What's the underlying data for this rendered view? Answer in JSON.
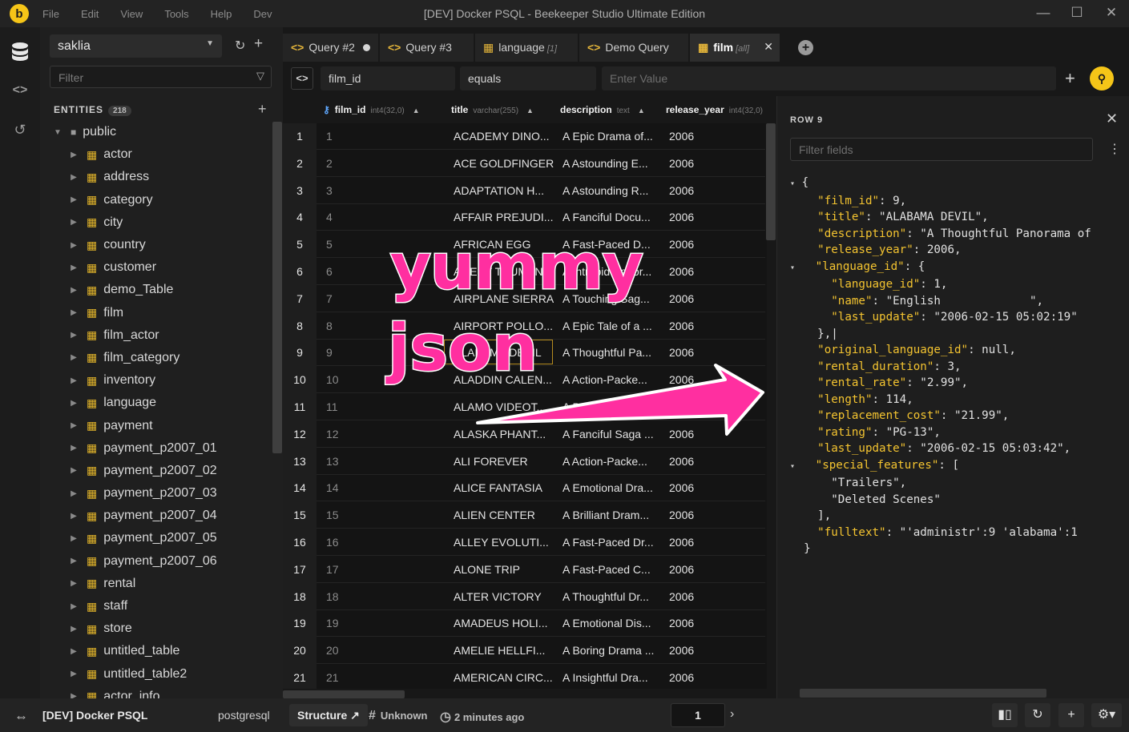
{
  "app": {
    "logo": "b",
    "title": "[DEV] Docker PSQL - Beekeeper Studio Ultimate Edition",
    "menu": [
      "File",
      "Edit",
      "View",
      "Tools",
      "Help",
      "Dev"
    ]
  },
  "sidebar": {
    "connection": "saklia",
    "filter_placeholder": "Filter",
    "entities_label": "ENTITIES",
    "entities_count": "218",
    "schema": "public",
    "tables": [
      "actor",
      "address",
      "category",
      "city",
      "country",
      "customer",
      "demo_Table",
      "film",
      "film_actor",
      "film_category",
      "inventory",
      "language",
      "payment",
      "payment_p2007_01",
      "payment_p2007_02",
      "payment_p2007_03",
      "payment_p2007_04",
      "payment_p2007_05",
      "payment_p2007_06",
      "rental",
      "staff",
      "store",
      "untitled_table",
      "untitled_table2",
      "actor_info"
    ]
  },
  "tabs": [
    {
      "label": "Query #2",
      "kind": "query",
      "sub": ""
    },
    {
      "label": "Query #3",
      "kind": "query",
      "sub": ""
    },
    {
      "label": "language",
      "kind": "table",
      "sub": "[1]"
    },
    {
      "label": "Demo Query",
      "kind": "query",
      "sub": ""
    },
    {
      "label": "film",
      "kind": "table",
      "sub": "[all]"
    }
  ],
  "filter": {
    "field": "film_id",
    "operator": "equals",
    "value_placeholder": "Enter Value"
  },
  "grid": {
    "columns": [
      {
        "name": "film_id",
        "type": "int4(32,0)"
      },
      {
        "name": "title",
        "type": "varchar(255)"
      },
      {
        "name": "description",
        "type": "text"
      },
      {
        "name": "release_year",
        "type": "int4(32,0)"
      }
    ],
    "rows": [
      [
        "1",
        "1",
        "ACADEMY DINO...",
        "A Epic Drama of...",
        "2006"
      ],
      [
        "2",
        "2",
        "ACE GOLDFINGER",
        "A Astounding E...",
        "2006"
      ],
      [
        "3",
        "3",
        "ADAPTATION H...",
        "A Astounding R...",
        "2006"
      ],
      [
        "4",
        "4",
        "AFFAIR PREJUDI...",
        "A Fanciful Docu...",
        "2006"
      ],
      [
        "5",
        "5",
        "AFRICAN EGG",
        "A Fast-Paced D...",
        "2006"
      ],
      [
        "6",
        "6",
        "AGENT TRUMAN",
        "A Intrepid Panor...",
        "2006"
      ],
      [
        "7",
        "7",
        "AIRPLANE SIERRA",
        "A Touching Sag...",
        "2006"
      ],
      [
        "8",
        "8",
        "AIRPORT POLLO...",
        "A Epic Tale of a ...",
        "2006"
      ],
      [
        "9",
        "9",
        "ALABAMA DEVIL",
        "A Thoughtful Pa...",
        "2006"
      ],
      [
        "10",
        "10",
        "ALADDIN CALEN...",
        "A Action-Packe...",
        "2006"
      ],
      [
        "11",
        "11",
        "ALAMO VIDEOT...",
        "A Boring Epistle...",
        "2006"
      ],
      [
        "12",
        "12",
        "ALASKA PHANT...",
        "A Fanciful Saga ...",
        "2006"
      ],
      [
        "13",
        "13",
        "ALI FOREVER",
        "A Action-Packe...",
        "2006"
      ],
      [
        "14",
        "14",
        "ALICE FANTASIA",
        "A Emotional Dra...",
        "2006"
      ],
      [
        "15",
        "15",
        "ALIEN CENTER",
        "A Brilliant Dram...",
        "2006"
      ],
      [
        "16",
        "16",
        "ALLEY EVOLUTI...",
        "A Fast-Paced Dr...",
        "2006"
      ],
      [
        "17",
        "17",
        "ALONE TRIP",
        "A Fast-Paced C...",
        "2006"
      ],
      [
        "18",
        "18",
        "ALTER VICTORY",
        "A Thoughtful Dr...",
        "2006"
      ],
      [
        "19",
        "19",
        "AMADEUS HOLI...",
        "A Emotional Dis...",
        "2006"
      ],
      [
        "20",
        "20",
        "AMELIE HELLFI...",
        "A Boring Drama ...",
        "2006"
      ],
      [
        "21",
        "21",
        "AMERICAN CIRC...",
        "A Insightful Dra...",
        "2006"
      ]
    ]
  },
  "panel": {
    "title": "ROW 9",
    "filter_placeholder": "Filter fields",
    "json_lines": [
      {
        "i": 0,
        "a": "▾",
        "t": "{"
      },
      {
        "i": 1,
        "k": "\"film_id\"",
        "t": ": 9,"
      },
      {
        "i": 1,
        "k": "\"title\"",
        "t": ": \"ALABAMA DEVIL\","
      },
      {
        "i": 1,
        "k": "\"description\"",
        "t": ": \"A Thoughtful Panorama of"
      },
      {
        "i": 1,
        "k": "\"release_year\"",
        "t": ": 2006,"
      },
      {
        "i": 1,
        "a": "▾",
        "k": "\"language_id\"",
        "t": ": {"
      },
      {
        "i": 2,
        "k": "\"language_id\"",
        "t": ": 1,"
      },
      {
        "i": 2,
        "k": "\"name\"",
        "t": ": \"English             \","
      },
      {
        "i": 2,
        "k": "\"last_update\"",
        "t": ": \"2006-02-15 05:02:19\""
      },
      {
        "i": 1,
        "t": "},|"
      },
      {
        "i": 1,
        "k": "\"original_language_id\"",
        "t": ": null,"
      },
      {
        "i": 1,
        "k": "\"rental_duration\"",
        "t": ": 3,"
      },
      {
        "i": 1,
        "k": "\"rental_rate\"",
        "t": ": \"2.99\","
      },
      {
        "i": 1,
        "k": "\"length\"",
        "t": ": 114,"
      },
      {
        "i": 1,
        "k": "\"replacement_cost\"",
        "t": ": \"21.99\","
      },
      {
        "i": 1,
        "k": "\"rating\"",
        "t": ": \"PG-13\","
      },
      {
        "i": 1,
        "k": "\"last_update\"",
        "t": ": \"2006-02-15 05:03:42\","
      },
      {
        "i": 1,
        "a": "▾",
        "k": "\"special_features\"",
        "t": ": ["
      },
      {
        "i": 2,
        "t": "\"Trailers\","
      },
      {
        "i": 2,
        "t": "\"Deleted Scenes\""
      },
      {
        "i": 1,
        "t": "],"
      },
      {
        "i": 1,
        "k": "\"fulltext\"",
        "t": ": \"'administr':9 'alabama':1"
      },
      {
        "i": 0,
        "t": "}"
      }
    ]
  },
  "statusbar": {
    "connection": "[DEV] Docker PSQL",
    "db_type": "postgresql",
    "structure_label": "Structure ↗",
    "unknown_label": "Unknown",
    "time_label": "2 minutes ago",
    "page": "1"
  },
  "overlay": {
    "word1": "yummy",
    "word2": "json",
    "color": "#ff2fa0"
  },
  "colors": {
    "accent": "#f5c518",
    "table_icon": "#e2b42a",
    "json_key": "#f4c430",
    "key_icon": "#5fa8ff"
  }
}
